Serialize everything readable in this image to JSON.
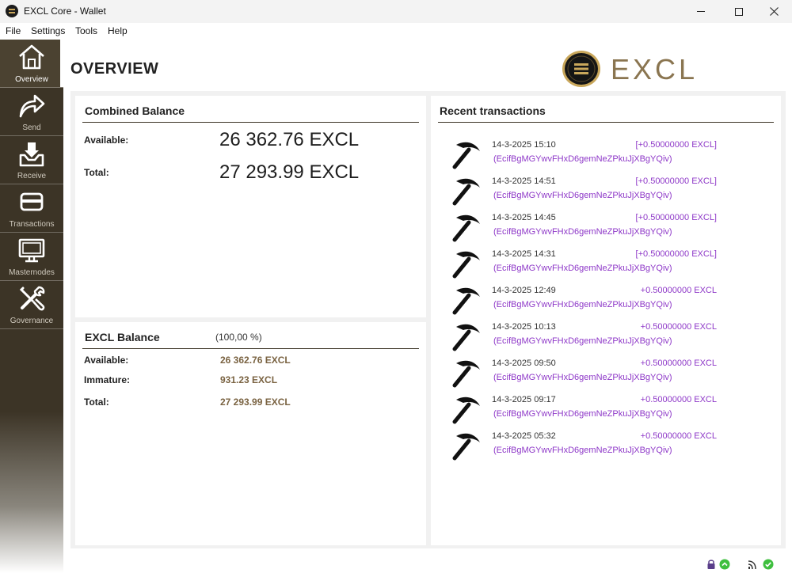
{
  "window": {
    "title": "EXCL Core - Wallet"
  },
  "menu": {
    "items": [
      "File",
      "Settings",
      "Tools",
      "Help"
    ]
  },
  "sidebar": {
    "items": [
      {
        "label": "Overview",
        "icon": "home-icon",
        "active": true
      },
      {
        "label": "Send",
        "icon": "send-arrow-icon",
        "active": false
      },
      {
        "label": "Receive",
        "icon": "receive-tray-icon",
        "active": false
      },
      {
        "label": "Transactions",
        "icon": "card-icon",
        "active": false
      },
      {
        "label": "Masternodes",
        "icon": "monitor-icon",
        "active": false
      },
      {
        "label": "Governance",
        "icon": "tools-icon",
        "active": false
      }
    ]
  },
  "page": {
    "title": "OVERVIEW",
    "logo_text": "EXCL"
  },
  "combined": {
    "title": "Combined Balance",
    "available_label": "Available:",
    "available_value": "26 362.76 EXCL",
    "total_label": "Total:",
    "total_value": "27 293.99 EXCL"
  },
  "excl_balance": {
    "title": "EXCL Balance",
    "percent": "(100,00 %)",
    "available_label": "Available:",
    "available_value": "26 362.76 EXCL",
    "immature_label": "Immature:",
    "immature_value": "931.23 EXCL",
    "total_label": "Total:",
    "total_value": "27 293.99 EXCL"
  },
  "recent": {
    "title": "Recent transactions",
    "transactions": [
      {
        "date": "14-3-2025 15:10",
        "amount": "[+0.50000000 EXCL]",
        "address": "(EcifBgMGYwvFHxD6gemNeZPkuJjXBgYQiv)"
      },
      {
        "date": "14-3-2025 14:51",
        "amount": "[+0.50000000 EXCL]",
        "address": "(EcifBgMGYwvFHxD6gemNeZPkuJjXBgYQiv)"
      },
      {
        "date": "14-3-2025 14:45",
        "amount": "[+0.50000000 EXCL]",
        "address": "(EcifBgMGYwvFHxD6gemNeZPkuJjXBgYQiv)"
      },
      {
        "date": "14-3-2025 14:31",
        "amount": "[+0.50000000 EXCL]",
        "address": "(EcifBgMGYwvFHxD6gemNeZPkuJjXBgYQiv)"
      },
      {
        "date": "14-3-2025 12:49",
        "amount": "+0.50000000 EXCL",
        "address": "(EcifBgMGYwvFHxD6gemNeZPkuJjXBgYQiv)"
      },
      {
        "date": "14-3-2025 10:13",
        "amount": "+0.50000000 EXCL",
        "address": "(EcifBgMGYwvFHxD6gemNeZPkuJjXBgYQiv)"
      },
      {
        "date": "14-3-2025 09:50",
        "amount": "+0.50000000 EXCL",
        "address": "(EcifBgMGYwvFHxD6gemNeZPkuJjXBgYQiv)"
      },
      {
        "date": "14-3-2025 09:17",
        "amount": "+0.50000000 EXCL",
        "address": "(EcifBgMGYwvFHxD6gemNeZPkuJjXBgYQiv)"
      },
      {
        "date": "14-3-2025 05:32",
        "amount": "+0.50000000 EXCL",
        "address": "(EcifBgMGYwvFHxD6gemNeZPkuJjXBgYQiv)"
      }
    ]
  },
  "status": {
    "icons": [
      "lock-icon",
      "staking-icon",
      "network-icon",
      "synced-check-icon"
    ]
  },
  "colors": {
    "sidebar": "#3c3426",
    "accent_gold": "#8a7550",
    "tx_purple": "#8e38c8"
  }
}
